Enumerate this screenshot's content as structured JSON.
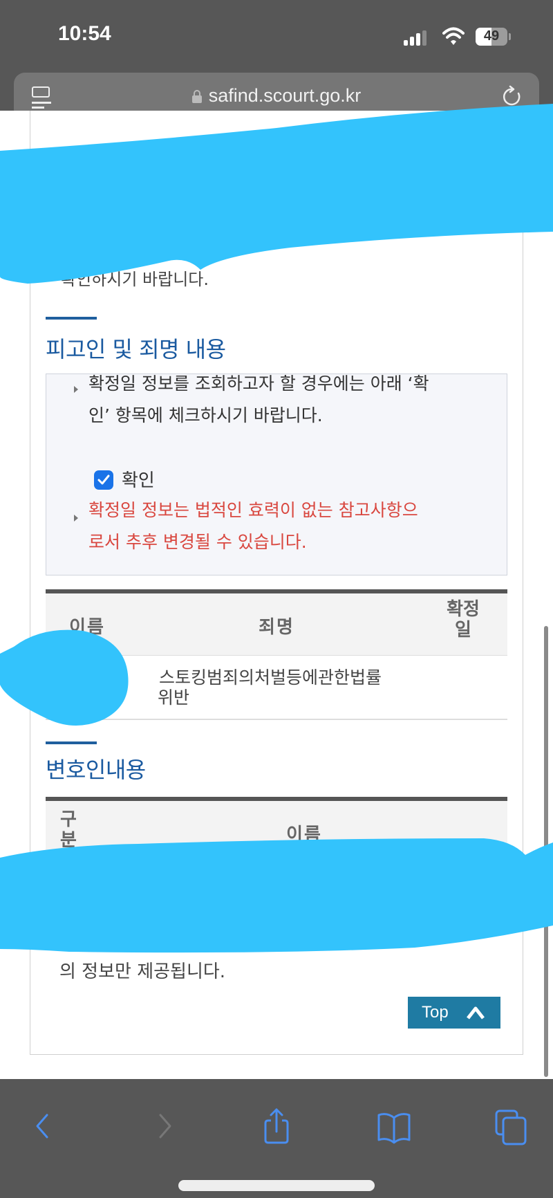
{
  "status_bar": {
    "time": "10:54",
    "battery_percent": "49",
    "battery_level": 0.49
  },
  "browser": {
    "url": "safind.scourt.go.kr",
    "icons": {
      "reader": "reader-mode-icon",
      "lock": "lock-icon",
      "reload": "reload-icon"
    }
  },
  "page": {
    "intro_partial_text": "확인하시기 바랍니다.",
    "defendant_section": {
      "title": "피고인 및 죄명 내용",
      "notice_line1": "확정일 정보를 조회하고자 할 경우에는 아래 ‘확",
      "notice_line2": "인’ 항목에 체크하시기 바랍니다.",
      "checkbox_label": "확인",
      "checkbox_checked": true,
      "warning_line1": "확정일 정보는 법적인 효력이 없는 참고사항으",
      "warning_line2": "로서 추후 변경될 수 있습니다.",
      "table": {
        "headers": [
          "이름",
          "죄명",
          "확정일"
        ],
        "rows": [
          {
            "name": "[redacted]",
            "charge_line1": "스토킹범죄의처벌등에관한법률",
            "charge_line2": "위반",
            "confirmed_date": ""
          }
        ]
      }
    },
    "lawyer_section": {
      "title": "변호인내용",
      "table": {
        "headers": [
          "구분",
          "이름"
        ]
      },
      "footer_text": "의 정보만 제공됩니다."
    },
    "top_button": {
      "label": "Top",
      "icon": "chevron-up-icon"
    }
  },
  "toolbar": {
    "items": [
      {
        "name": "back",
        "icon": "chevron-left-icon",
        "enabled": true
      },
      {
        "name": "forward",
        "icon": "chevron-right-icon",
        "enabled": false
      },
      {
        "name": "share",
        "icon": "share-icon",
        "enabled": true
      },
      {
        "name": "bookmarks",
        "icon": "book-icon",
        "enabled": true
      },
      {
        "name": "tabs",
        "icon": "tabs-icon",
        "enabled": true
      }
    ]
  },
  "colors": {
    "accent_blue": "#1a5aa0",
    "warning_red": "#d9473f",
    "top_button": "#1f7ba3",
    "toolbar_icon": "#4a8ef0",
    "redaction": "#33c3fc"
  }
}
